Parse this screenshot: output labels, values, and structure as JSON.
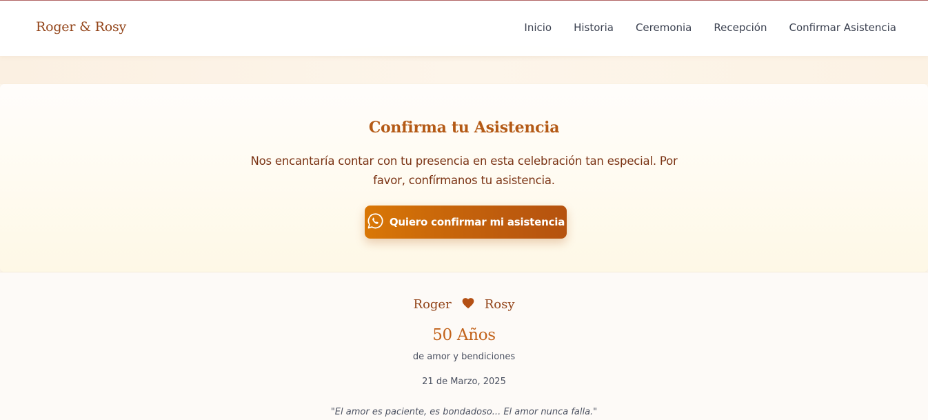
{
  "nav": {
    "brand": "Roger & Rosy",
    "links": [
      "Inicio",
      "Historia",
      "Ceremonia",
      "Recepción",
      "Confirmar Asistencia"
    ]
  },
  "rsvp": {
    "title": "Confirma tu Asistencia",
    "description": "Nos encantaría contar con tu presencia en esta celebración tan especial. Por favor, confírmanos tu asistencia.",
    "button_label": "Quiero confirmar mi asistencia",
    "button_icon": "whatsapp-icon"
  },
  "footer": {
    "name_left": "Roger",
    "name_right": "Rosy",
    "heart_icon": "heart-icon",
    "years": "50 Años",
    "subtitle": "de amor y bendiciones",
    "date": "21 de Marzo, 2025",
    "quote": "\"El amor es paciente, es bondadoso... El amor nunca falla.\""
  },
  "colors": {
    "accent": "#b45a16",
    "brand": "#93451a",
    "button_start": "#d97706",
    "button_end": "#b5520f",
    "text_dark": "#3b4150"
  }
}
